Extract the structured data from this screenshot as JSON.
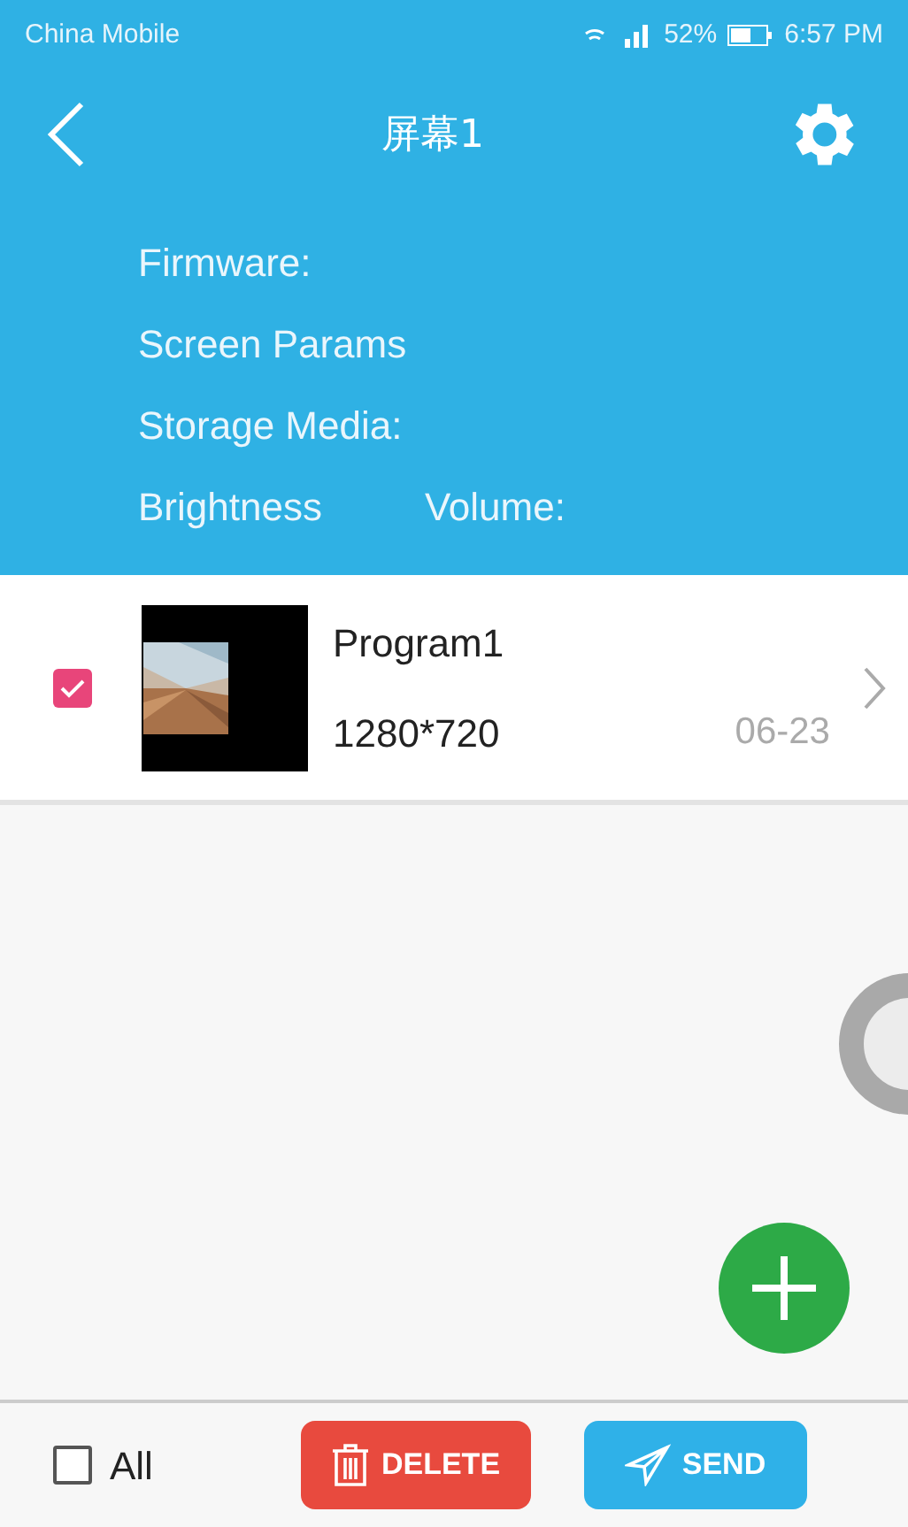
{
  "status_bar": {
    "carrier": "China Mobile",
    "battery": "52%",
    "time": "6:57 PM"
  },
  "header": {
    "title": "屏幕1"
  },
  "info": [
    {
      "label": "Firmware:"
    },
    {
      "label": "Screen Params"
    },
    {
      "label": "Storage Media:"
    }
  ],
  "info_row": [
    "Brightness",
    "Volume:"
  ],
  "programs": [
    {
      "name": "Program1",
      "resolution": "1280*720",
      "date": "06-23",
      "checked": true
    }
  ],
  "footer": {
    "select_all": {
      "label": "All",
      "checked": false
    },
    "buttons": [
      {
        "kind": "delete",
        "label": "DELETE"
      },
      {
        "kind": "send",
        "label": "SEND"
      }
    ]
  }
}
